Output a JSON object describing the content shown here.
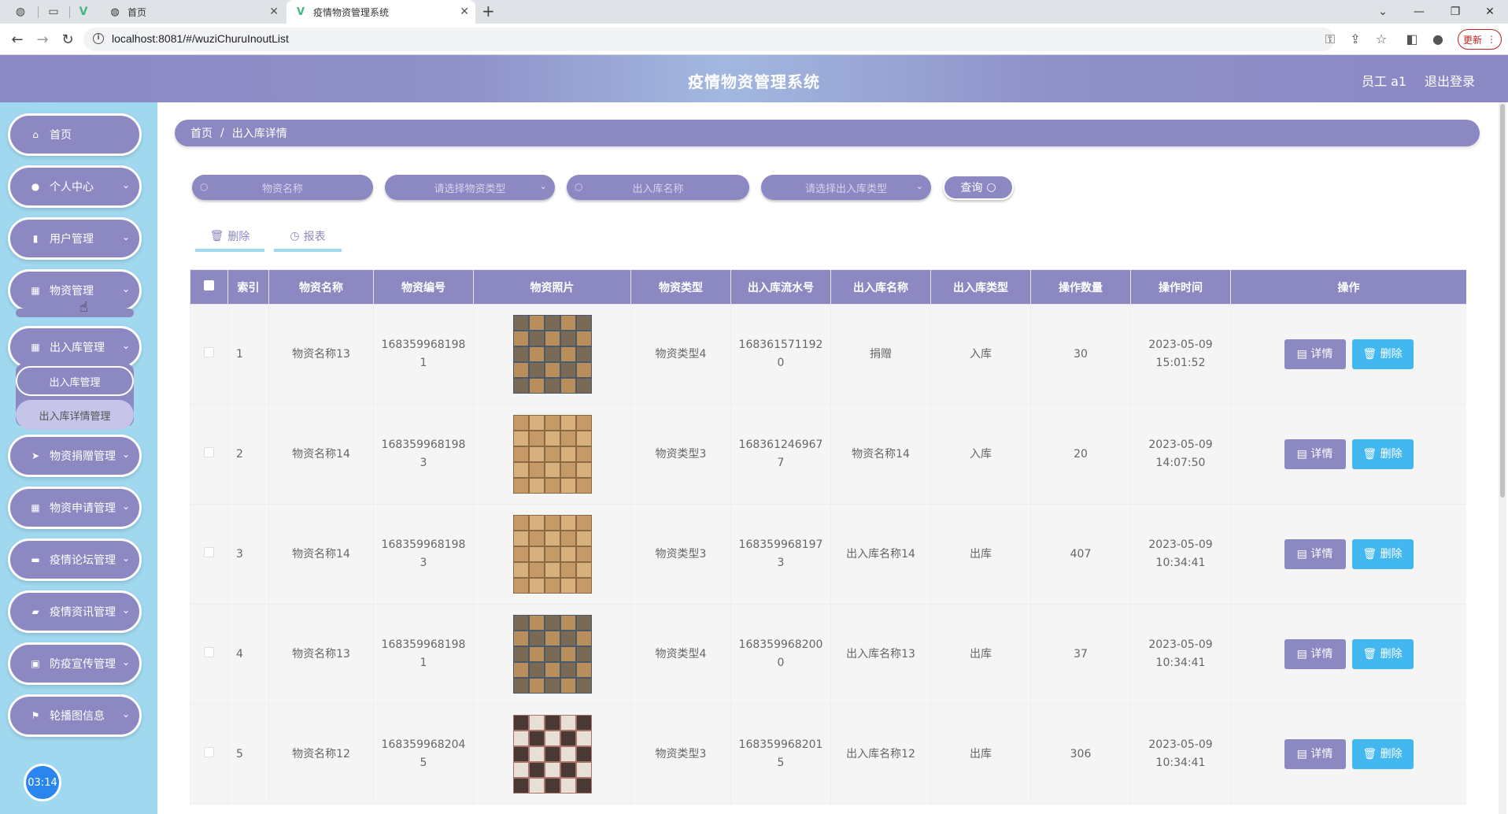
{
  "browser": {
    "tabs": [
      {
        "title": "首页",
        "icon": "globe-icon"
      },
      {
        "title": "疫情物资管理系统",
        "icon": "vue-logo-icon"
      }
    ],
    "url": "localhost:8081/#/wuziChuruInoutList",
    "update_label": "更新"
  },
  "header": {
    "title": "疫情物资管理系统",
    "user": "员工 a1",
    "logout": "退出登录"
  },
  "sidebar": {
    "items": [
      {
        "label": "首页",
        "icon": "home-icon"
      },
      {
        "label": "个人中心",
        "icon": "user-icon"
      },
      {
        "label": "用户管理",
        "icon": "bar-chart-icon"
      },
      {
        "label": "物资管理",
        "icon": "grid-icon"
      },
      {
        "label": "出入库管理",
        "icon": "grid-icon"
      },
      {
        "label": "物资捐赠管理",
        "icon": "send-icon"
      },
      {
        "label": "物资申请管理",
        "icon": "grid-icon"
      },
      {
        "label": "疫情论坛管理",
        "icon": "chat-icon"
      },
      {
        "label": "疫情资讯管理",
        "icon": "thumb-icon"
      },
      {
        "label": "防疫宣传管理",
        "icon": "case-icon"
      },
      {
        "label": "轮播图信息",
        "icon": "flag-icon"
      }
    ],
    "submenu": [
      "出入库管理",
      "出入库详情管理"
    ],
    "clock": "03:14"
  },
  "breadcrumb": {
    "home": "首页",
    "sep": "/",
    "current": "出入库详情"
  },
  "search": {
    "name_placeholder": "物资名称",
    "type_placeholder": "请选择物资类型",
    "inout_name_placeholder": "出入库名称",
    "inout_type_placeholder": "请选择出入库类型",
    "query_label": "查询"
  },
  "actions": {
    "delete_label": "删除",
    "report_label": "报表"
  },
  "table": {
    "columns": [
      "索引",
      "物资名称",
      "物资编号",
      "物资照片",
      "物资类型",
      "出入库流水号",
      "出入库名称",
      "出入库类型",
      "操作数量",
      "操作时间",
      "操作"
    ],
    "detail_label": "详情",
    "delete_label": "删除",
    "rows": [
      {
        "index": "1",
        "name": "物资名称13",
        "code": [
          "1683599681981"
        ],
        "type": "物资类型4",
        "serial": [
          "1683615711920"
        ],
        "inout_name": "捐赠",
        "inout_type": "入库",
        "qty": "30",
        "time": "2023-05-09 15:01:52"
      },
      {
        "index": "2",
        "name": "物资名称14",
        "code": [
          "1683599681983"
        ],
        "type": "物资类型3",
        "serial": [
          "1683612469677"
        ],
        "inout_name": "物资名称14",
        "inout_type": "入库",
        "qty": "20",
        "time": "2023-05-09 14:07:50"
      },
      {
        "index": "3",
        "name": "物资名称14",
        "code": [
          "1683599681983"
        ],
        "type": "物资类型3",
        "serial": [
          "1683599681973"
        ],
        "inout_name": "出入库名称14",
        "inout_type": "出库",
        "qty": "407",
        "time": "2023-05-09 10:34:41"
      },
      {
        "index": "4",
        "name": "物资名称13",
        "code": [
          "1683599681981"
        ],
        "type": "物资类型4",
        "serial": [
          "1683599682000"
        ],
        "inout_name": "出入库名称13",
        "inout_type": "出库",
        "qty": "37",
        "time": "2023-05-09 10:34:41"
      },
      {
        "index": "5",
        "name": "物资名称12",
        "code": [
          "1683599682045"
        ],
        "type": "物资类型3",
        "serial": [
          "1683599682015"
        ],
        "inout_name": "出入库名称12",
        "inout_type": "出库",
        "qty": "306",
        "time": "2023-05-09 10:34:41"
      }
    ]
  }
}
